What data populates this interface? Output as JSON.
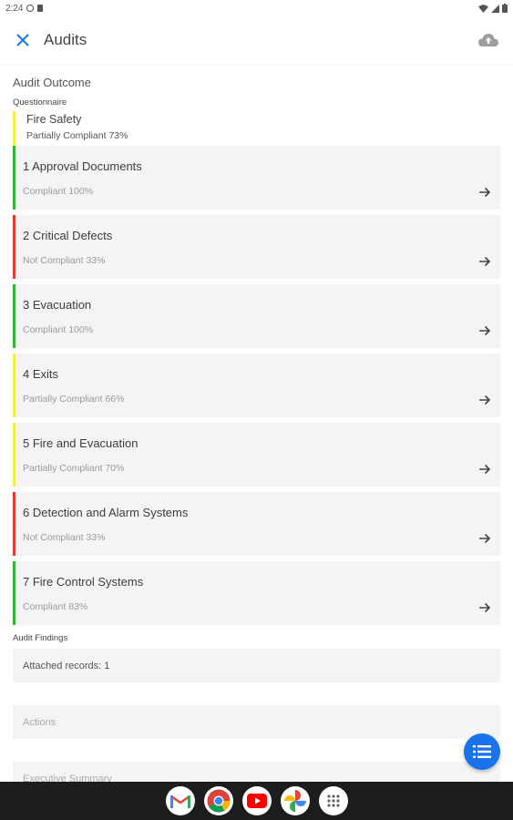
{
  "status_bar": {
    "time": "2:24"
  },
  "app_bar": {
    "title": "Audits"
  },
  "audit_outcome": {
    "title": "Audit Outcome",
    "questionnaire_label": "Questionnaire",
    "questionnaire": {
      "name": "Fire Safety",
      "status": "Partially Compliant 73%",
      "color": "#f5e94b"
    },
    "sections": [
      {
        "title": "1 Approval Documents",
        "status": "Compliant 100%",
        "color": "#2eb82e"
      },
      {
        "title": "2 Critical Defects",
        "status": "Not Compliant 33%",
        "color": "#e53935"
      },
      {
        "title": "3 Evacuation",
        "status": "Compliant 100%",
        "color": "#2eb82e"
      },
      {
        "title": "4 Exits",
        "status": "Partially Compliant 66%",
        "color": "#f5e94b"
      },
      {
        "title": "5 Fire and Evacuation",
        "status": "Partially Compliant 70%",
        "color": "#f5e94b"
      },
      {
        "title": "6 Detection and Alarm Systems",
        "status": "Not Compliant 33%",
        "color": "#e53935"
      },
      {
        "title": "7 Fire Control Systems",
        "status": "Compliant 83%",
        "color": "#2eb82e"
      }
    ]
  },
  "audit_findings": {
    "label": "Audit Findings",
    "attached_records": "Attached records: 1",
    "actions_placeholder": "Actions",
    "executive_summary_placeholder": "Executive Summary"
  },
  "colors": {
    "accent": "#1a73e8",
    "compliant": "#2eb82e",
    "partial": "#f5e94b",
    "not_compliant": "#e53935"
  },
  "icons": [
    "close-icon",
    "cloud-upload-icon",
    "arrow-right-icon",
    "list-icon",
    "gmail-icon",
    "chrome-icon",
    "youtube-icon",
    "photos-icon",
    "app-drawer-icon"
  ]
}
